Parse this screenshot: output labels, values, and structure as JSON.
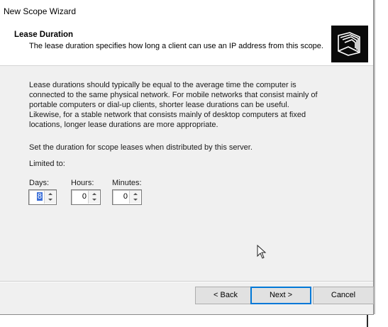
{
  "window": {
    "title": "New Scope Wizard"
  },
  "header": {
    "heading": "Lease Duration",
    "subtitle": "The lease duration specifies how long a client can use an IP address from this scope.",
    "icon": "folders-icon"
  },
  "body": {
    "paragraph_lines": [
      "Lease durations should typically be equal to the average time the computer is",
      "connected to the same physical network. For mobile networks that consist mainly of",
      "portable computers or dial-up clients, shorter lease durations can be useful.",
      "Likewise, for a stable network that consists mainly of desktop computers at fixed",
      "locations, longer lease durations are more appropriate."
    ],
    "instruction": "Set the duration for scope leases when distributed by this server.",
    "limited_label": "Limited to:"
  },
  "duration": {
    "days_label": "Days:",
    "days_value": "8",
    "hours_label": "Hours:",
    "hours_value": "0",
    "minutes_label": "Minutes:",
    "minutes_value": "0"
  },
  "buttons": {
    "back": "< Back",
    "next": "Next >",
    "cancel": "Cancel"
  },
  "colors": {
    "selection": "#3a6ed8",
    "default_button_border": "#0078d7",
    "dialog_background": "#f0f0f0"
  }
}
